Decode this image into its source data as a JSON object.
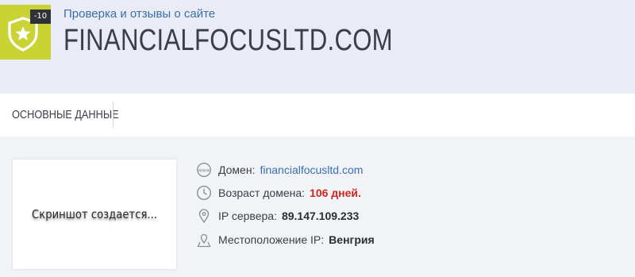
{
  "header": {
    "score": "-10",
    "subtitle": "Проверка и отзывы о сайте",
    "domain_title": "FINANCIALFOCUSLTD.COM",
    "badge_color": "#c9d334"
  },
  "tabs": [
    {
      "label": "ОСНОВНЫЕ ДАННЫЕ"
    }
  ],
  "screenshot": {
    "placeholder": "Скриншот создается..."
  },
  "info": {
    "domain": {
      "icon": "www-icon",
      "label": "Домен:",
      "value": "financialfocusltd.com"
    },
    "age": {
      "icon": "clock-icon",
      "label": "Возраст домена:",
      "value": "106 дней."
    },
    "ip": {
      "icon": "location-pin-icon",
      "label": "IP сервера:",
      "value": "89.147.109.233"
    },
    "location": {
      "icon": "map-pin-icon",
      "label": "Местоположение IP:",
      "value": "Венгрия"
    }
  },
  "colors": {
    "link": "#3a6fb0",
    "alert": "#d0261c"
  }
}
